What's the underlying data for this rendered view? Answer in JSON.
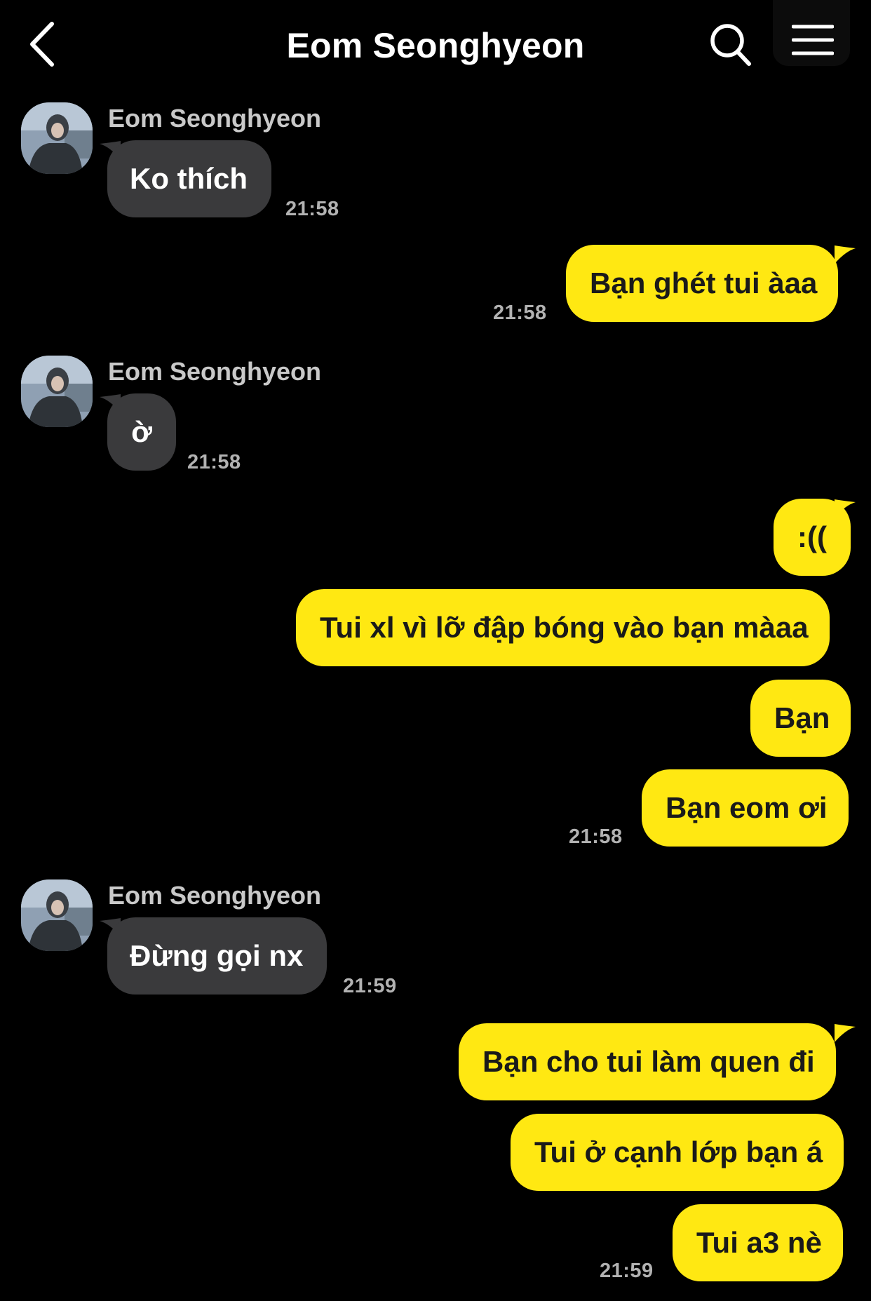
{
  "header": {
    "title": "Eom Seonghyeon"
  },
  "colors": {
    "background": "#000000",
    "incoming_bubble": "#3a3a3c",
    "outgoing_bubble": "#ffe812",
    "timestamp": "#b2b2b2"
  },
  "icons": {
    "back": "chevron-left-icon",
    "search": "search-icon",
    "menu": "hamburger-menu-icon"
  },
  "messages": {
    "g1": {
      "sender": "Eom Seonghyeon",
      "m1": "Ko thích",
      "time": "21:58"
    },
    "g2": {
      "m1": "Bạn ghét tui àaa",
      "time": "21:58"
    },
    "g3": {
      "sender": "Eom Seonghyeon",
      "m1": "ờ",
      "time": "21:58"
    },
    "g4": {
      "m1": ":((",
      "m2": "Tui xl vì lỡ đập bóng vào bạn màaa",
      "m3": "Bạn",
      "m4": "Bạn eom ơi",
      "time": "21:58"
    },
    "g5": {
      "sender": "Eom Seonghyeon",
      "m1": "Đừng gọi nx",
      "time": "21:59"
    },
    "g6": {
      "m1": "Bạn cho tui làm quen đi",
      "m2": "Tui ở cạnh lớp bạn á",
      "m3": "Tui a3 nè",
      "time": "21:59"
    }
  }
}
